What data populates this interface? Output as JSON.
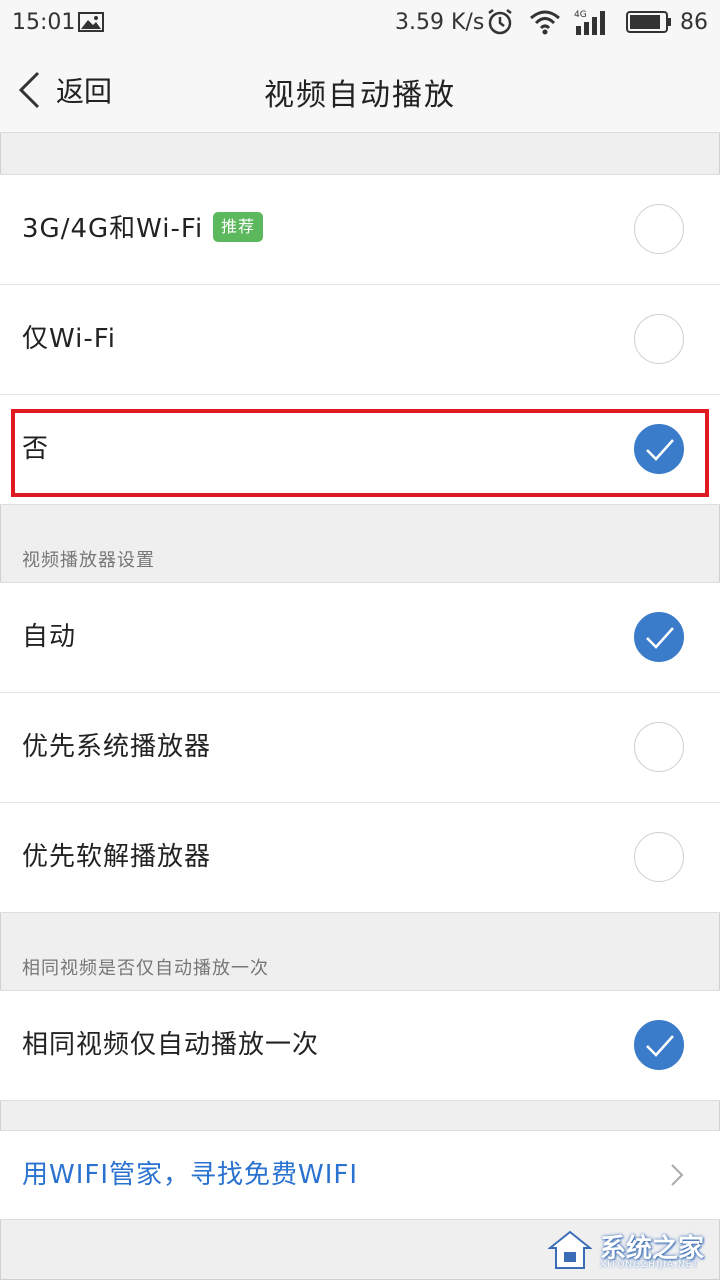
{
  "status_bar": {
    "time": "15:01",
    "speed": "3.59 K/s",
    "signal_type": "4G",
    "battery": "86"
  },
  "header": {
    "back_label": "返回",
    "title": "视频自动播放"
  },
  "autoplay_options": [
    {
      "label": "3G/4G和Wi-Fi",
      "badge": "推荐",
      "selected": false
    },
    {
      "label": "仅Wi-Fi",
      "selected": false
    },
    {
      "label": "否",
      "selected": true
    }
  ],
  "player_settings": {
    "section_title": "视频播放器设置",
    "options": [
      {
        "label": "自动",
        "selected": true
      },
      {
        "label": "优先系统播放器",
        "selected": false
      },
      {
        "label": "优先软解播放器",
        "selected": false
      }
    ]
  },
  "same_video": {
    "section_title": "相同视频是否仅自动播放一次",
    "options": [
      {
        "label": "相同视频仅自动播放一次",
        "selected": true
      }
    ]
  },
  "wifi_link": {
    "label": "用WIFI管家，寻找免费WIFI"
  },
  "watermark": {
    "text": "系统之家",
    "sub": "XITONGZHIJIA.NET"
  },
  "colors": {
    "accent": "#3a7cc9",
    "badge": "#5cb85c",
    "highlight": "#e01a22",
    "link": "#2a72d0"
  }
}
